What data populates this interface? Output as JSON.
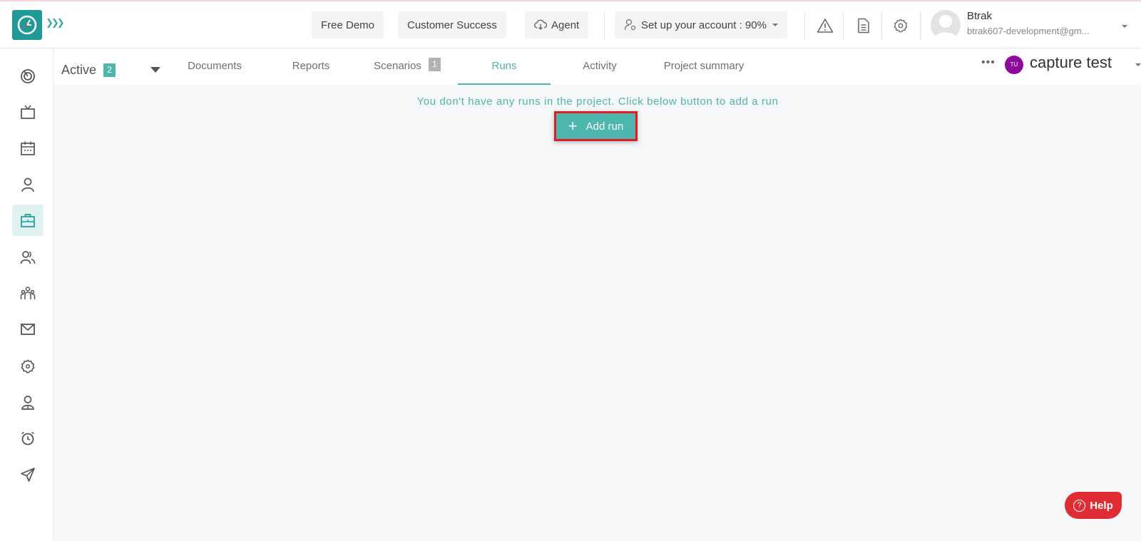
{
  "header": {
    "expand_icon": "triple-chevron-right",
    "buttons": {
      "free_demo": "Free Demo",
      "customer_success": "Customer Success",
      "agent": "Agent",
      "setup_account": "Set up your account : 90%"
    },
    "setup_progress_percent": 90,
    "user": {
      "name": "Btrak",
      "email": "btrak607-development@gm..."
    }
  },
  "sidebar": {
    "items": [
      {
        "icon": "dashboard-icon",
        "active": false
      },
      {
        "icon": "tv-icon",
        "active": false
      },
      {
        "icon": "calendar-icon",
        "active": false
      },
      {
        "icon": "user-icon",
        "active": false
      },
      {
        "icon": "briefcase-icon",
        "active": true
      },
      {
        "icon": "users-icon",
        "active": false
      },
      {
        "icon": "team-icon",
        "active": false
      },
      {
        "icon": "mail-icon",
        "active": false
      },
      {
        "icon": "settings-icon",
        "active": false
      },
      {
        "icon": "employee-icon",
        "active": false
      },
      {
        "icon": "alarm-icon",
        "active": false
      },
      {
        "icon": "send-icon",
        "active": false
      }
    ]
  },
  "tabsbar": {
    "status": {
      "label": "Active",
      "count": "2"
    },
    "tabs": [
      {
        "label": "Documents"
      },
      {
        "label": "Reports"
      },
      {
        "label": "Scenarios",
        "count": "1"
      },
      {
        "label": "Runs",
        "active": true
      },
      {
        "label": "Activity"
      },
      {
        "label": "Project summary"
      }
    ],
    "more": "•••",
    "project": {
      "initials": "TU",
      "name": "capture test"
    }
  },
  "main": {
    "empty_message": "You don't have any runs in the project. Click below button to add a run",
    "add_run_label": "Add run"
  },
  "help": {
    "label": "Help",
    "q": "?"
  },
  "colors": {
    "accent": "#4db6ad",
    "logo": "#1f9a96",
    "highlight": "#e21b23",
    "help": "#e02d35",
    "project_avatar": "#8e0a9b"
  }
}
